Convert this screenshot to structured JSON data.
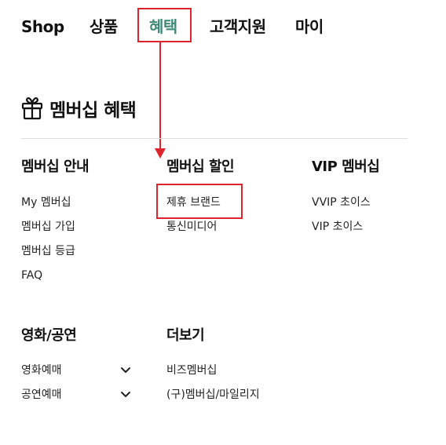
{
  "nav": {
    "items": [
      {
        "label": "Shop"
      },
      {
        "label": "상품"
      },
      {
        "label": "혜택"
      },
      {
        "label": "고객지원"
      },
      {
        "label": "마이"
      }
    ]
  },
  "section": {
    "icon": "gift-icon",
    "title": "멤버십 혜택"
  },
  "columns": {
    "membership_guide": {
      "title": "멤버십 안내",
      "links": [
        "My 멤버십",
        "멤버십 가입",
        "멤버십 등급",
        "FAQ"
      ]
    },
    "membership_discount": {
      "title": "멤버십 할인",
      "links": [
        "제휴 브랜드",
        "통신미디어"
      ]
    },
    "vip": {
      "title": "VIP 멤버십",
      "links": [
        "VVIP 초이스",
        "VIP 초이스"
      ]
    },
    "movie_show": {
      "title": "영화/공연",
      "dropdowns": [
        "영화예매",
        "공연예매"
      ]
    },
    "more": {
      "title": "더보기",
      "links": [
        "비즈멤버십",
        "(구)멤버십/마일리지"
      ]
    }
  },
  "annotation": {
    "color": "#e0242d",
    "active_nav_color": "#3f8a77"
  }
}
